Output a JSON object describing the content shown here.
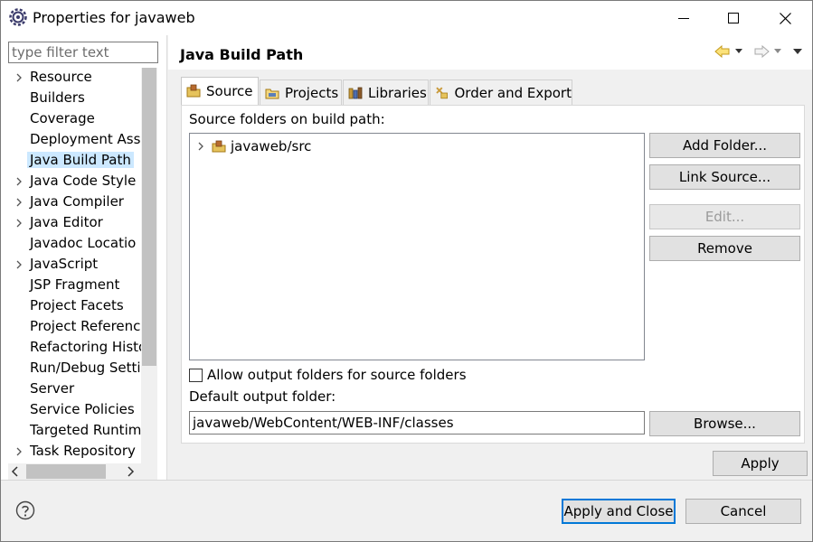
{
  "window": {
    "title": "Properties for javaweb",
    "controls": [
      "minimize-icon",
      "maximize-icon",
      "close-icon"
    ]
  },
  "filter": {
    "placeholder": "type filter text"
  },
  "sidebar": {
    "items": [
      {
        "label": "Resource",
        "expandable": true
      },
      {
        "label": "Builders",
        "expandable": false
      },
      {
        "label": "Coverage",
        "expandable": false
      },
      {
        "label": "Deployment Ass",
        "expandable": false
      },
      {
        "label": "Java Build Path",
        "expandable": false,
        "selected": true
      },
      {
        "label": "Java Code Style",
        "expandable": true
      },
      {
        "label": "Java Compiler",
        "expandable": true
      },
      {
        "label": "Java Editor",
        "expandable": true
      },
      {
        "label": "Javadoc Locatio",
        "expandable": false
      },
      {
        "label": "JavaScript",
        "expandable": true
      },
      {
        "label": "JSP Fragment",
        "expandable": false
      },
      {
        "label": "Project Facets",
        "expandable": false
      },
      {
        "label": "Project Referenc",
        "expandable": false
      },
      {
        "label": "Refactoring Histo",
        "expandable": false
      },
      {
        "label": "Run/Debug Setti",
        "expandable": false
      },
      {
        "label": "Server",
        "expandable": false
      },
      {
        "label": "Service Policies",
        "expandable": false
      },
      {
        "label": "Targeted Runtim",
        "expandable": false
      },
      {
        "label": "Task Repository",
        "expandable": true
      }
    ]
  },
  "page": {
    "title": "Java Build Path"
  },
  "tabs": [
    {
      "label": "Source",
      "icon": "source-folder-icon",
      "active": true
    },
    {
      "label": "Projects",
      "icon": "projects-icon",
      "active": false
    },
    {
      "label": "Libraries",
      "icon": "libraries-icon",
      "active": false
    },
    {
      "label": "Order and Export",
      "icon": "order-export-icon",
      "active": false
    }
  ],
  "source_tab": {
    "section_label": "Source folders on build path:",
    "folders": [
      "javaweb/src"
    ],
    "buttons": {
      "add_folder": "Add Folder...",
      "link_source": "Link Source...",
      "edit": "Edit...",
      "remove": "Remove"
    },
    "allow_output_label": "Allow output folders for source folders",
    "allow_output_checked": false,
    "default_output_label": "Default output folder:",
    "default_output_value": "javaweb/WebContent/WEB-INF/classes",
    "browse": "Browse..."
  },
  "actions": {
    "apply": "Apply",
    "apply_and_close": "Apply and Close",
    "cancel": "Cancel"
  },
  "colors": {
    "selection": "#cce8ff",
    "default_button_border": "#0078d7",
    "nav_arrow": "#e3b92f"
  }
}
